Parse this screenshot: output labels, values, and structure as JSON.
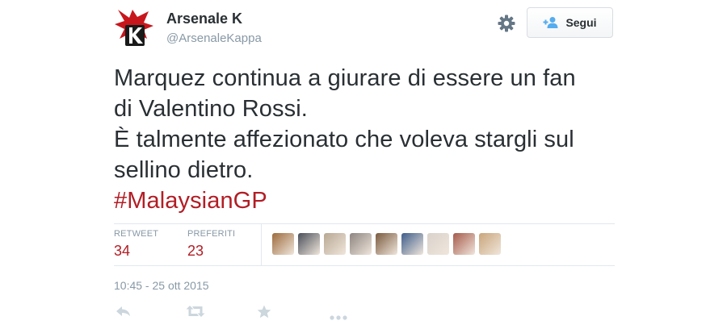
{
  "header": {
    "author_name": "Arsenale K",
    "author_handle": "@ArsenaleKappa",
    "follow_label": "Segui",
    "avatar_icon": "red-bird-k-logo",
    "settings_icon": "gear-icon",
    "follow_icon": "add-user-icon"
  },
  "tweet": {
    "lines": [
      "Marquez continua a giurare di essere un fan",
      "di Valentino Rossi.",
      "È talmente affezionato che voleva stargli sul",
      "sellino dietro."
    ],
    "hashtag": "#MalaysianGP"
  },
  "stats": {
    "retweet_label": "RETWEET",
    "retweet_count": "34",
    "favorites_label": "PREFERITI",
    "favorites_count": "23"
  },
  "favoriters": [
    {
      "icon": "user-avatar",
      "color": "#9c6b3c"
    },
    {
      "icon": "user-avatar",
      "color": "#4a4f5a"
    },
    {
      "icon": "user-avatar",
      "color": "#b8a893"
    },
    {
      "icon": "user-avatar",
      "color": "#8d8480"
    },
    {
      "icon": "user-avatar",
      "color": "#7a5a3e"
    },
    {
      "icon": "user-avatar",
      "color": "#3d5d8a"
    },
    {
      "icon": "user-avatar",
      "color": "#d9d2cb"
    },
    {
      "icon": "user-avatar",
      "color": "#a55a4a"
    },
    {
      "icon": "user-avatar",
      "color": "#c9a57a"
    }
  ],
  "timestamp": "10:45 - 25 ott 2015",
  "actions": [
    "reply-icon",
    "retweet-icon",
    "favorite-icon",
    "more-icon"
  ],
  "colors": {
    "accent": "#b21d25",
    "text": "#292f33",
    "muted": "#8899a6",
    "action_icon": "#ccd6dd",
    "follow_icon": "#55acee"
  }
}
